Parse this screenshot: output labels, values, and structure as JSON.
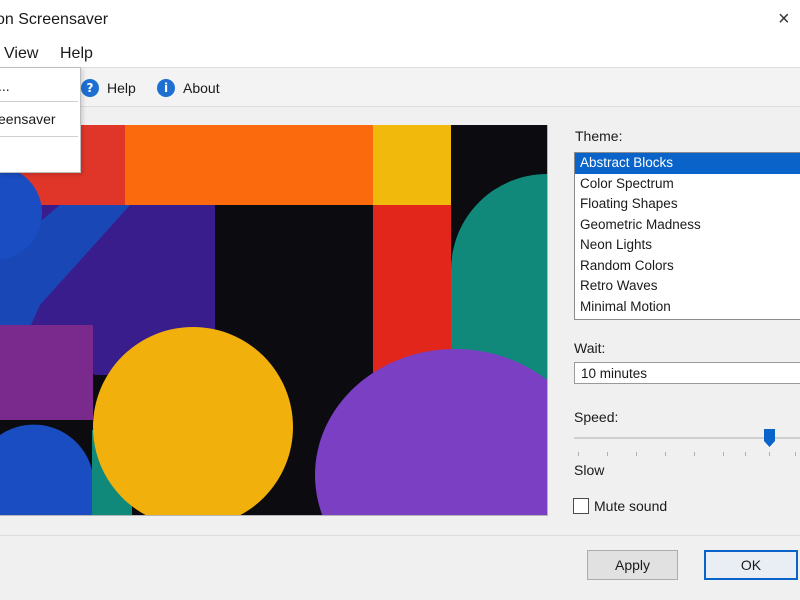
{
  "window": {
    "title": "on Screensaver",
    "close_glyph": "×"
  },
  "menu": {
    "items": [
      "View",
      "Help"
    ]
  },
  "dropdown": {
    "items": [
      "...",
      "eensaver"
    ]
  },
  "toolbar": {
    "help_label": "Help",
    "about_label": "About",
    "help_icon": "?",
    "about_icon": "i"
  },
  "settings": {
    "theme_label": "Theme:",
    "themes": [
      "Abstract Blocks",
      "Color Spectrum",
      "Floating Shapes",
      "Geometric Madness",
      "Neon Lights",
      "Random Colors",
      "Retro Waves",
      "Minimal Motion"
    ],
    "selected_theme": "Abstract Blocks",
    "wait_label": "Wait:",
    "wait_value": "10 minutes",
    "speed_label": "Speed:",
    "speed_min_label": "Slow",
    "speed_value": 0.85,
    "mute_label": "Mute sound",
    "mute_checked": false
  },
  "buttons": {
    "apply": "Apply",
    "ok": "OK"
  },
  "colors": {
    "accent": "#0a63c9"
  }
}
